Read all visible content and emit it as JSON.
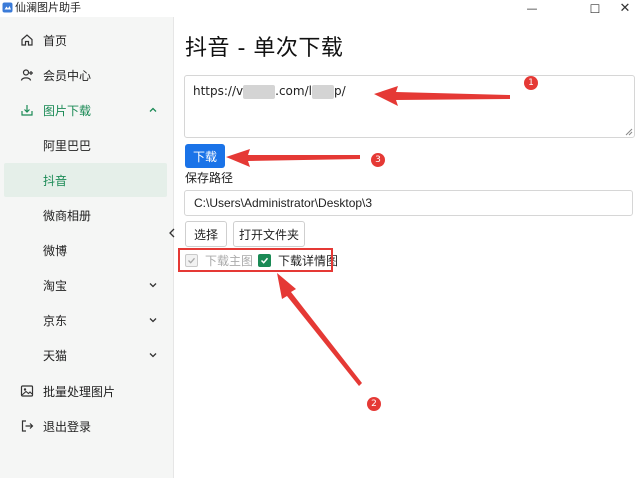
{
  "window": {
    "title": "仙澜图片助手",
    "minimize_glyph": "—",
    "maximize_glyph": "☐",
    "close_glyph": "✕"
  },
  "sidebar": {
    "items": [
      {
        "label": "首页",
        "icon": "home-icon"
      },
      {
        "label": "会员中心",
        "icon": "user-add-icon"
      },
      {
        "label": "图片下载",
        "icon": "download-icon",
        "expanded": true
      },
      {
        "label": "阿里巴巴"
      },
      {
        "label": "抖音",
        "active": true
      },
      {
        "label": "微商相册"
      },
      {
        "label": "微博"
      },
      {
        "label": "淘宝",
        "has_children": true
      },
      {
        "label": "京东",
        "has_children": true
      },
      {
        "label": "天猫",
        "has_children": true
      },
      {
        "label": "批量处理图片",
        "icon": "image-icon"
      },
      {
        "label": "退出登录",
        "icon": "logout-icon"
      }
    ]
  },
  "main": {
    "title": "抖音 - 单次下载",
    "url": {
      "prefix": "https://v",
      "middle": ".com/",
      "mid2": "l",
      "suffix": "p/"
    },
    "download_button": "下载",
    "save_path_label": "保存路径",
    "save_path_value": "C:\\Users\\Administrator\\Desktop\\3",
    "choose_button": "选择",
    "open_folder_button": "打开文件夹",
    "options": [
      {
        "label": "下载主图",
        "checked": true,
        "disabled": true
      },
      {
        "label": "下载详情图",
        "checked": true,
        "disabled": false
      }
    ]
  },
  "annotations": {
    "color": "#e53935",
    "badges": [
      "1",
      "2",
      "3"
    ]
  },
  "colors": {
    "accent_green": "#1a8a55",
    "primary_blue": "#1a73e8",
    "annotation_red": "#e53935"
  }
}
